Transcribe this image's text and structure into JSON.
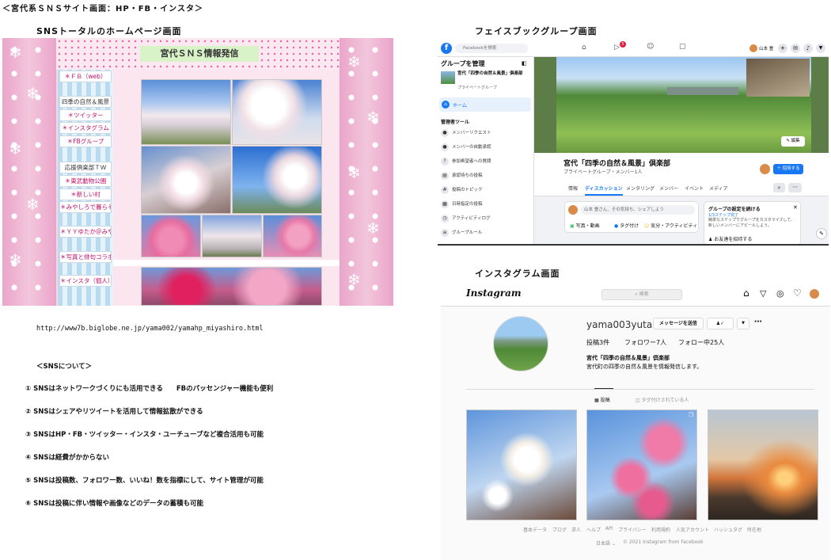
{
  "page_title": "＜宮代系ＳＮＳサイト画面：HP・FB・インスタ＞",
  "captions": {
    "hp": "SNSトータルのホームページ画面",
    "fb": "フェイスブックグループ画面",
    "ig": "インスタグラム画面"
  },
  "hp": {
    "banner": "宮代ＳＮＳ情報発信",
    "menu": [
      "＊ＦＢ（web）",
      "四季の自然＆風景",
      "＊ツイッター",
      "＊インスタグラム",
      "＊FBグループ",
      "",
      "応援倶楽部ＴＷ",
      "＊東武動物公園",
      "＊新しい村",
      "＊みやしろで暮らそう",
      "",
      "＊ＹＹゆたか＠みやしろ",
      "",
      "＊写真と俳句コラボ",
      "",
      "＊インスタ（個人）"
    ],
    "url": "http://www7b.biglobe.ne.jp/yama002/yamahp_miyashiro.html"
  },
  "sns_about": {
    "heading": "＜SNSについて＞",
    "points": [
      "① SNSはネットワークづくりにも活用できる　　FBのパッセンジャー機能も便利",
      "② SNSはシェアやリツイートを活用して情報拡散ができる",
      "③ SNSはHP・FB・ツイッター・インスタ・ユーチューブなど複合活用も可能",
      "④ SNSは経費がかからない",
      "⑤ SNSは投稿数、フォロワー数、いいね！数を指標にして、サイト管理が可能",
      "⑥ SNSは投稿に伴い情報や画像などのデータの蓄積も可能"
    ]
  },
  "fb": {
    "search_placeholder": "Facebookを検索",
    "notif_count": "5",
    "user_name": "山本 豊",
    "sidebar_title": "グループを管理",
    "group_name": "宮代「四季の自然＆風景」倶楽部",
    "group_privacy": "プライベートグループ",
    "home": "ホーム",
    "admin_tools": "管理者ツール",
    "admin_items": [
      "メンバーリクエスト",
      "メンバーの自動承認",
      "参加希望者への質問",
      "承認待ちの投稿",
      "投稿のトピック",
      "日時指定の投稿",
      "アクティビティログ",
      "グループルール"
    ],
    "edit_btn": "編集",
    "title": "宮代「四季の自然＆風景」倶楽部",
    "meta": "プライベートグループ・メンバー1人",
    "invite_btn": "＋ 招待する",
    "tabs": [
      "情報",
      "ディスカッション",
      "メンタリング",
      "メンバー",
      "イベント",
      "メディア"
    ],
    "composer_placeholder": "山本 豊さん、その気持ち、シェアしよう",
    "composer_actions": [
      "写真・動画",
      "タグ付け",
      "気分・アクティビティ"
    ],
    "setup_title": "グループの設定を続ける",
    "setup_progress": "1/3ステップ完了",
    "setup_desc": "簡単なステップでグループをカスタマイズして、新しいメンバーにアピールしよう。",
    "invite_friends": "お友達を招待する"
  },
  "ig": {
    "logo": "Instagram",
    "search_placeholder": "検索",
    "username": "yama003yuta",
    "message_btn": "メッセージを送信",
    "stats": [
      "投稿3件",
      "フォロワー7人",
      "フォロー中25人"
    ],
    "bio_name": "宮代「四季の自然＆風景」倶楽部",
    "bio": "宮代町の四季の自然＆風景を情報発信します。",
    "tabs": [
      "投稿",
      "タグ付けされている人"
    ],
    "footer_links": [
      "基本データ",
      "ブログ",
      "求人",
      "ヘルプ",
      "API",
      "プライバシー",
      "利用規約",
      "人気アカウント",
      "ハッシュタグ",
      "所在地"
    ],
    "footer_lang": "日本語",
    "footer_copy": "© 2021 Instagram from Facebook"
  }
}
